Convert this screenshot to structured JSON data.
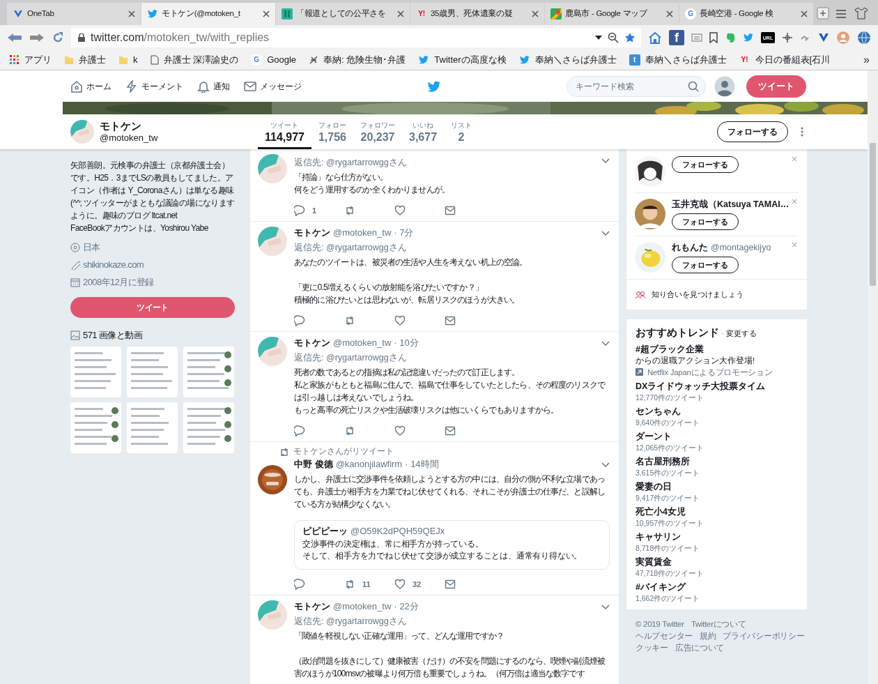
{
  "browser": {
    "tabs": [
      {
        "title": "OneTab",
        "kind": "onetab",
        "selected": false
      },
      {
        "title": "モトケン(@motoken_t",
        "kind": "twitter",
        "selected": true
      },
      {
        "title": "「報道としての公平さを",
        "kind": "green",
        "selected": false
      },
      {
        "title": "35歳男、死体遺棄の疑",
        "kind": "yahoo",
        "glyph": "Y!",
        "selected": false
      },
      {
        "title": "鹿島市 - Google マップ",
        "kind": "maps",
        "selected": false
      },
      {
        "title": "長崎空港 - Google 検",
        "kind": "google",
        "glyph": "G",
        "selected": false
      }
    ],
    "address": {
      "host": "twitter.com",
      "path": "/motoken_tw/with_replies"
    },
    "extensions": [
      {
        "kind": "facebook",
        "glyph": "f"
      },
      {
        "kind": "reader"
      },
      {
        "kind": "bookmark"
      },
      {
        "kind": "evernote"
      },
      {
        "kind": "bird"
      },
      {
        "kind": "url",
        "glyph": "URL"
      },
      {
        "kind": "move"
      },
      {
        "kind": "chain"
      },
      {
        "kind": "vee"
      },
      {
        "kind": "profile"
      },
      {
        "kind": "globe"
      }
    ],
    "bookmarks": [
      {
        "label": "アプリ",
        "kind": "apps"
      },
      {
        "label": "弁護士",
        "kind": "folder"
      },
      {
        "label": "k",
        "kind": "folder"
      },
      {
        "label": "弁護士 深澤諭史の",
        "kind": "page"
      },
      {
        "label": "Google",
        "kind": "google",
        "glyph": "G"
      },
      {
        "label": "奉納: 危険生物･弁護",
        "kind": "bug"
      },
      {
        "label": "Twitterの高度な検",
        "kind": "bird"
      },
      {
        "label": "奉納＼さらば弁護士",
        "kind": "bird"
      },
      {
        "label": "奉納＼さらば弁護士",
        "kind": "tbox",
        "glyph": "t"
      },
      {
        "label": "今日の番組表[石川",
        "kind": "yahoo",
        "glyph": "Y!"
      }
    ],
    "more": "»"
  },
  "twitter_nav": {
    "items": [
      {
        "label": "ホーム",
        "kind": "home"
      },
      {
        "label": "モーメント",
        "kind": "bolt"
      },
      {
        "label": "通知",
        "kind": "bell"
      },
      {
        "label": "メッセージ",
        "kind": "mail"
      }
    ],
    "search_placeholder": "キーワード検索",
    "tweet_button": "ツイート"
  },
  "profile_nav": {
    "name": "モトケン",
    "handle": "@motoken_tw",
    "stats": [
      {
        "label": "ツイート",
        "value": "114,977",
        "selected": true
      },
      {
        "label": "フォロー",
        "value": "1,756",
        "selected": false
      },
      {
        "label": "フォロワー",
        "value": "20,237",
        "selected": false
      },
      {
        "label": "いいね",
        "value": "3,677",
        "selected": false
      },
      {
        "label": "リスト",
        "value": "2",
        "selected": false
      }
    ],
    "follow_button": "フォローする"
  },
  "profile": {
    "bio": "矢部善朗。元検事の弁護士（京都弁護士会）です。H25．3までLSの教員もしてました。アイコン（作者は Y_Coronaさん）は単なる趣味(^^; ツイッターがまともな議論の場になりますように。趣味のブログ ",
    "bio_link": "ltcat.net",
    "bio_after": "FaceBookアカウントは、Yoshirou Yabe",
    "location": "日本",
    "url": "shikinokaze.com",
    "joined": "2008年12月に登録",
    "tweet_button": "ツイート",
    "media_label": "571 画像と動画"
  },
  "tweets": [
    {
      "reply": {
        "prefix": "返信先:",
        "user": "@rygartarrowgg",
        "suffix": "さん"
      },
      "text": [
        [
          "「持論」なら仕方がない。",
          "何をどう運用するのか全くわかりませんが。"
        ]
      ],
      "counts": {
        "reply": "1"
      },
      "actions": true
    },
    {
      "name": "モトケン",
      "handle": "@motoken_tw",
      "time": "· 7分",
      "reply": {
        "prefix": "返信先:",
        "user": "@rygartarrowgg",
        "suffix": "さん"
      },
      "text": [
        [
          "あなたのツイートは、被災者の生活や人生を考えない机上の空論。"
        ],
        [
          "「更に0.5増えるくらいの放射能を浴びたいですか？」",
          "積極的に浴びたいとは思わないが、転居リスクのほうが大きい。"
        ]
      ],
      "actions": true
    },
    {
      "name": "モトケン",
      "handle": "@motoken_tw",
      "time": "· 10分",
      "reply": {
        "prefix": "返信先:",
        "user": "@rygartarrowgg",
        "suffix": "さん"
      },
      "text": [
        [
          "死者の数であるとの指摘は私の記憶違いだったので訂正します。",
          "私と家族がもともと福島に住んで、福島で仕事をしていたとしたら、その程度のリスクでは引っ越しは考えないでしょうね。",
          "もっと高率の死亡リスクや生活破壊リスクは他にいくらでもありますから。"
        ]
      ],
      "actions": true
    },
    {
      "retweeted_by": "モトケンさんがリツイート",
      "name": "中野 俊德",
      "handle": "@kanonjilawfirm",
      "time": "· 14時間",
      "text": [
        [
          "しかし、弁護士に交渉事件を依頼しようとする方の中には、自分の側が不利な立場であっても、弁護士が相手方を力業でねじ伏せてくれる、それこそが弁護士の仕事だ、と誤解している方が結構少なくない。"
        ]
      ],
      "quote": {
        "name": "ピピピーッ",
        "handle": "@O59K2dPQH59QEJx",
        "text": [
          [
            "交渉事件の決定権は、常に相手方が持っている。",
            "そして、相手方を力でねじ伏せて交渉が成立することは、通常有り得ない。"
          ]
        ]
      },
      "counts": {
        "retweet": "11",
        "like": "32"
      },
      "actions": true
    },
    {
      "name": "モトケン",
      "handle": "@motoken_tw",
      "time": "· 22分",
      "reply": {
        "prefix": "返信先:",
        "user": "@rygartarrowgg",
        "suffix": "さん"
      },
      "text": [
        [
          "「閾値を軽視しない正確な運用」って、どんな運用ですか？"
        ],
        [
          "（政治問題を抜きにして）健康被害（だけ）の不安を問題にするのなら、喫煙や副流煙被害のほうが100msvの被曝より何万倍も重要でしょうね。（何万倍は適当な数字です"
        ]
      ]
    }
  ],
  "who_to_follow": {
    "items": [
      {
        "button": "フォローする"
      },
      {
        "name": "玉井克哉（Katsuya TAMAI…",
        "button": "フォローする"
      },
      {
        "name": "れもんた",
        "handle": "@montagekijyo",
        "button": "フォローする"
      }
    ],
    "find_friends": "知り合いを見つけましょう"
  },
  "trends": {
    "title": "おすすめトレンド",
    "separator": "·",
    "change": "変更する",
    "items": [
      {
        "name": "#超ブラック企業",
        "description": "からの退職アクション大作登場!",
        "promoted": "Netflix Japanによるプロモーション"
      },
      {
        "name": "DXライドウォッチ大投票タイム",
        "count": "12,770件のツイート"
      },
      {
        "name": "センちゃん",
        "count": "9,640件のツイート"
      },
      {
        "name": "ダーント",
        "count": "12,065件のツイート"
      },
      {
        "name": "名古屋刑務所",
        "count": "3,615件のツイート"
      },
      {
        "name": "愛妻の日",
        "count": "9,417件のツイート"
      },
      {
        "name": "死亡小4女児",
        "count": "10,957件のツイート"
      },
      {
        "name": "キャサリン",
        "count": "8,718件のツイート"
      },
      {
        "name": "実質賃金",
        "count": "47,718件のツイート"
      },
      {
        "name": "#バイキング",
        "count": "1,662件のツイート"
      }
    ]
  },
  "footer": [
    [
      "© 2019 Twitter",
      "Twitterについて"
    ],
    [
      "ヘルプセンター",
      "規約",
      "プライバシーポリシー"
    ],
    [
      "クッキー",
      "広告について"
    ]
  ]
}
